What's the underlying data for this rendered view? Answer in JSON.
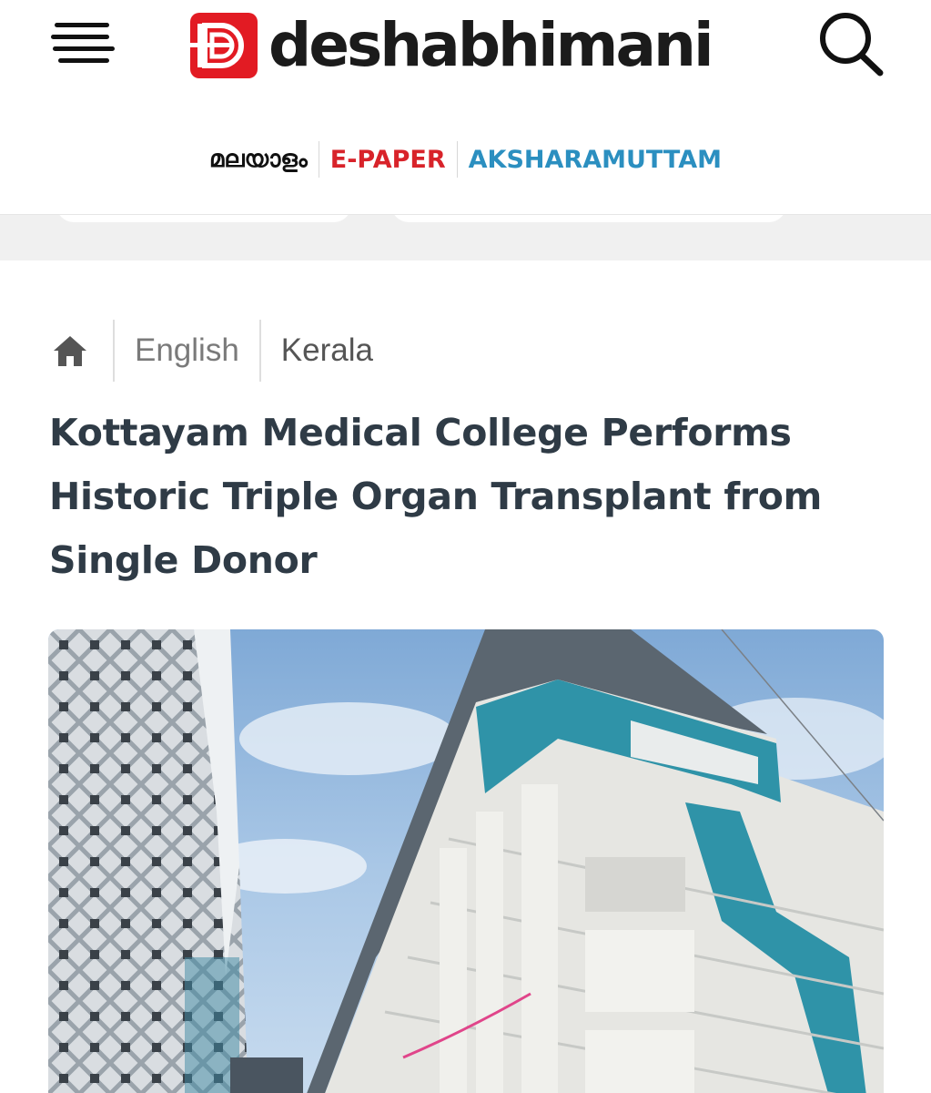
{
  "header": {
    "brand": "deshabhimani",
    "links": [
      {
        "label": "മലയാളം"
      },
      {
        "label": "E-PAPER"
      },
      {
        "label": "AKSHARAMUTTAM"
      }
    ]
  },
  "breadcrumb": {
    "items": [
      {
        "label": "English"
      },
      {
        "label": "Kerala"
      }
    ]
  },
  "article": {
    "title": "Kottayam Medical College Performs Historic Triple Organ Transplant from Single Donor"
  },
  "icons": {
    "menu": "hamburger-menu-icon",
    "search": "search-icon",
    "home": "home-icon",
    "logo": "deshabhimani-logo-mark"
  },
  "colors": {
    "brand_red": "#e21b23",
    "epaper_red": "#d8232a",
    "aksharamuttam_blue": "#2b8fc0",
    "headline": "#2f3b46"
  }
}
